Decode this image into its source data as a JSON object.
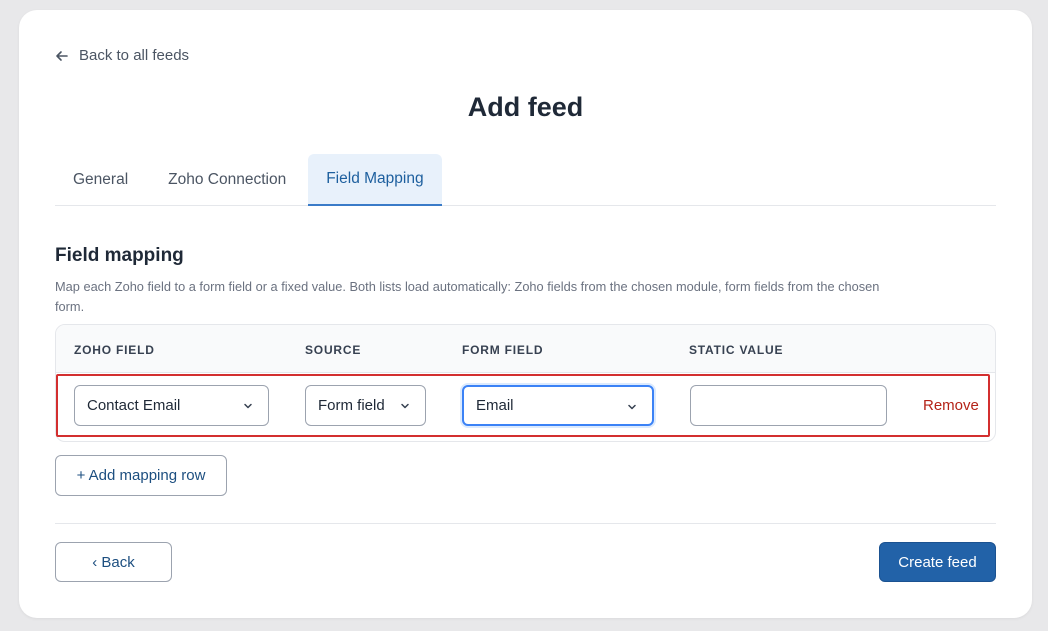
{
  "nav": {
    "back_link": "Back to all feeds"
  },
  "page": {
    "title": "Add feed"
  },
  "tabs": [
    {
      "label": "General",
      "active": false
    },
    {
      "label": "Zoho Connection",
      "active": false
    },
    {
      "label": "Field Mapping",
      "active": true
    }
  ],
  "section": {
    "title": "Field mapping",
    "description": "Map each Zoho field to a form field or a fixed value. Both lists load automatically: Zoho fields from the chosen module, form fields from the chosen form."
  },
  "table": {
    "headers": [
      "ZOHO FIELD",
      "SOURCE",
      "FORM FIELD",
      "STATIC VALUE"
    ],
    "rows": [
      {
        "zoho_field": "Contact Email",
        "source": "Form field",
        "form_field": "Email",
        "static_value": "",
        "remove_label": "Remove"
      }
    ]
  },
  "actions": {
    "add_row": "+ Add mapping row",
    "back": "‹ Back",
    "create": "Create feed"
  },
  "colors": {
    "accent": "#2262a8",
    "active_tab_bg": "#e8f1fb",
    "danger": "#b42318",
    "highlight_outline": "#d32f2f"
  },
  "icons": {
    "back": "arrow-left-icon",
    "dropdown": "chevron-down-icon"
  }
}
